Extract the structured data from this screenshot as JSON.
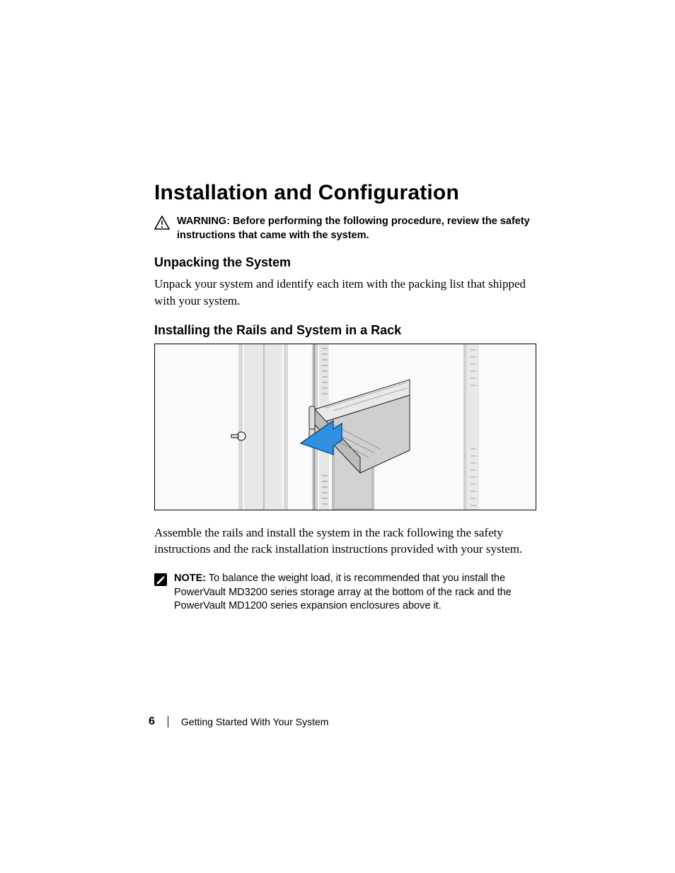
{
  "heading_main": "Installation and Configuration",
  "warning": {
    "label": "WARNING:",
    "text": "Before performing the following procedure, review the safety instructions that came with the system."
  },
  "section_unpack": {
    "heading": "Unpacking the System",
    "body": "Unpack your system and identify each item with the packing list that shipped with your system."
  },
  "section_install": {
    "heading": "Installing the Rails and System in a Rack",
    "body_after_figure": "Assemble the rails and install the system in the rack following the safety instructions and the rack installation instructions provided with your system."
  },
  "note": {
    "label": "NOTE:",
    "text": "To balance the weight load, it is recommended that you install the PowerVault MD3200 series storage array at the bottom of the rack and the PowerVault MD1200 series expansion enclosures above it."
  },
  "footer": {
    "page_number": "6",
    "title": "Getting Started With Your System"
  }
}
